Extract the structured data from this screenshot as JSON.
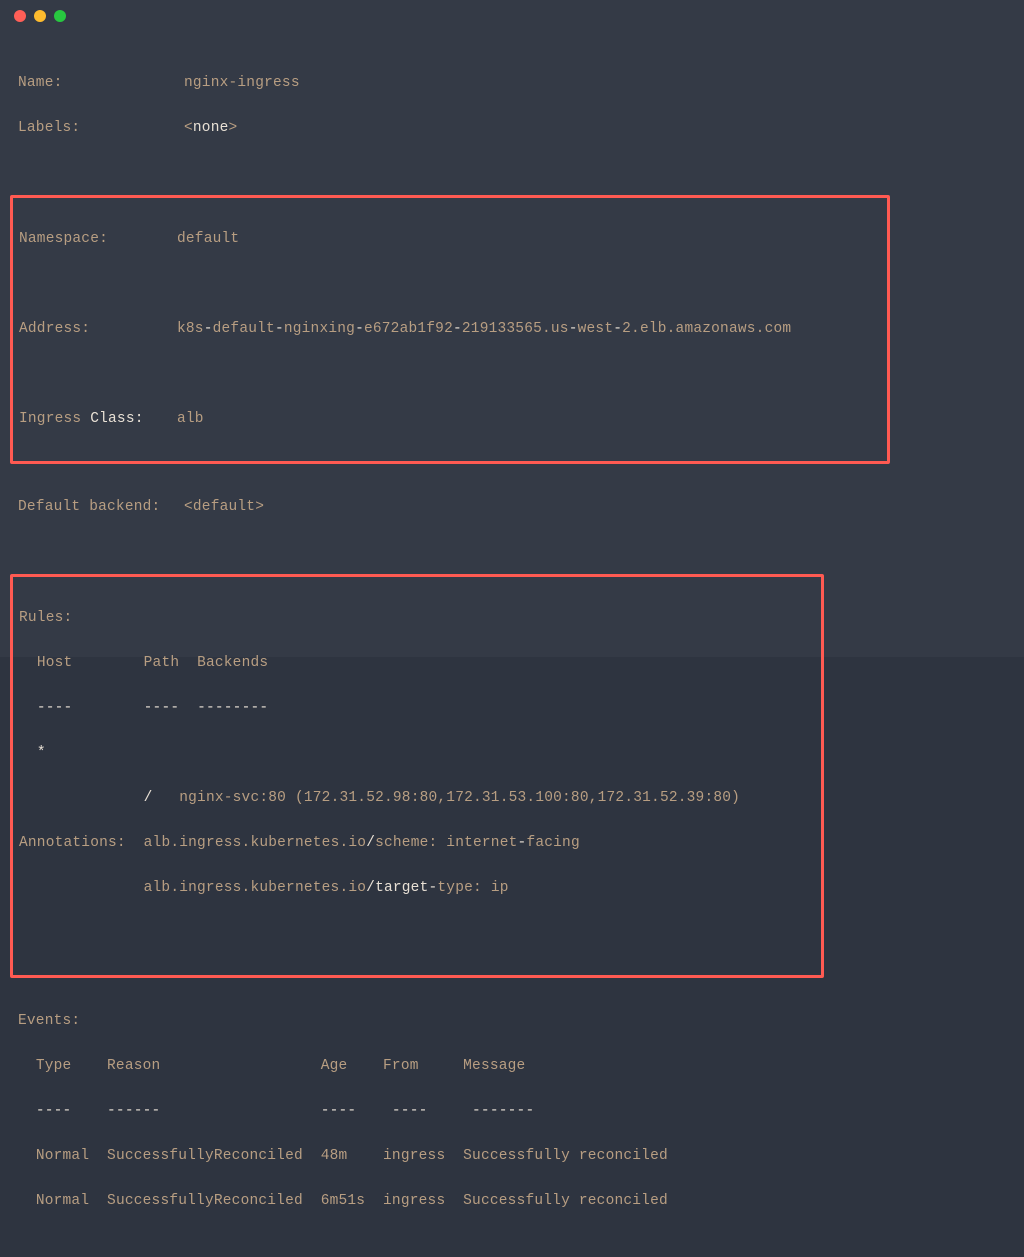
{
  "titlebar": {},
  "ingress": {
    "name_label": "Name:",
    "name_value": "nginx-ingress",
    "labels_label": "Labels:",
    "labels_value_prefix": "<",
    "labels_value_bold": "none",
    "labels_value_suffix": ">",
    "namespace_label": "Namespace:",
    "namespace_value": "default",
    "address_label": "Address:",
    "address_p1": "k8s",
    "address_p2": "default",
    "address_p3": "nginxing",
    "address_p4": "e672ab1f92",
    "address_p5": "219133565.us",
    "address_p6": "west",
    "address_p7": "2.elb.amazonaws.com",
    "ingress_label1": "Ingress ",
    "ingress_label2": "Class:",
    "ingress_class_value": "alb",
    "default_backend_label": "Default backend:",
    "default_backend_value": "<default>",
    "rules_label": "Rules:",
    "rules_host": "Host",
    "rules_path": "Path",
    "rules_backends": "Backends",
    "rules_host_u": "----",
    "rules_path_u": "----",
    "rules_backends_u": "--------",
    "rules_star": "*",
    "rules_slash": "/",
    "rules_backend_svc": "nginx-svc",
    "rules_backend_port": ":80 (172.31.52.98:80,172.31.53.100:80,172.31.52.39:80)",
    "annotations_label": "Annotations:",
    "anno1_key": "alb.ingress.kubernetes.io",
    "anno1_slash": "/",
    "anno1_sub": "scheme: internet",
    "anno1_tail": "facing",
    "anno2_key": "alb.ingress.kubernetes.io",
    "anno2_slash": "/",
    "anno2_sub1": "target",
    "anno2_sub2": "type: ip",
    "events_label": "Events:",
    "ev_type": "Type",
    "ev_reason": "Reason",
    "ev_age": "Age",
    "ev_from": "From",
    "ev_message": "Message",
    "ev_type_u": "----",
    "ev_reason_u": "------",
    "ev_age_u": "----",
    "ev_from_u": "----",
    "ev_message_u": "-------",
    "events": [
      {
        "type": "Normal",
        "reason": "SuccessfullyReconciled",
        "age": "48m",
        "from": "ingress",
        "message": "Successfully reconciled"
      },
      {
        "type": "Normal",
        "reason": "SuccessfullyReconciled",
        "age": "6m51s",
        "from": "ingress",
        "message": "Successfully reconciled"
      }
    ]
  }
}
